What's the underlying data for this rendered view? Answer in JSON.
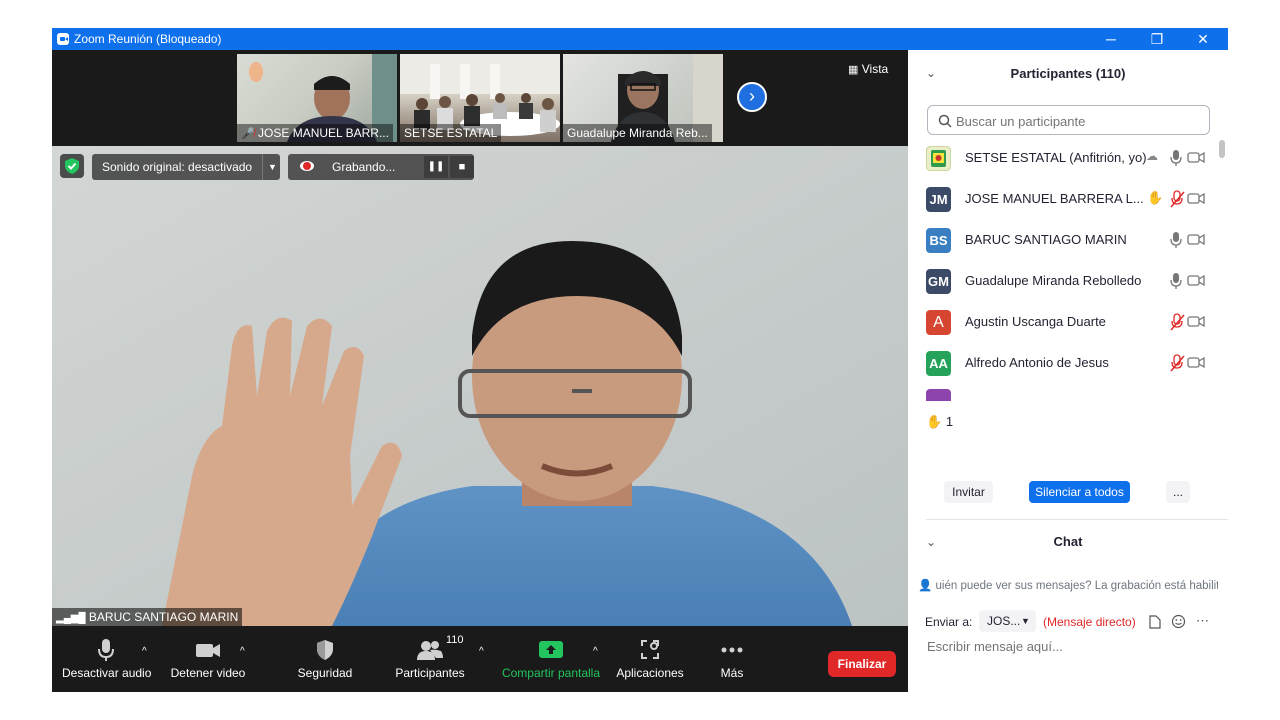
{
  "window": {
    "title": "Zoom Reunión (Bloqueado)"
  },
  "thumbnails": [
    {
      "name": "JOSE MANUEL BARR..."
    },
    {
      "name": "SETSE ESTATAL"
    },
    {
      "name": "Guadalupe Miranda Reb..."
    }
  ],
  "view": {
    "label": "Vista"
  },
  "audio_chip": {
    "label": "Sonido original: desactivado"
  },
  "recording": {
    "label": "Grabando..."
  },
  "speaker": {
    "name": "BARUC SANTIAGO MARIN"
  },
  "toolbar": {
    "audio": "Desactivar audio",
    "video": "Detener video",
    "security": "Seguridad",
    "participants": "Participantes",
    "participants_count": "110",
    "share": "Compartir pantalla",
    "apps": "Aplicaciones",
    "more": "Más",
    "end": "Finalizar"
  },
  "participants_panel": {
    "title": "Participantes (110)",
    "search_placeholder": "Buscar un participante",
    "list": [
      {
        "initials": "",
        "name": "SETSE ESTATAL (Anfitrión, yo)",
        "color": "#e9edc8"
      },
      {
        "initials": "JM",
        "name": "JOSE MANUEL BARRERA L...",
        "color": "#3b4a66"
      },
      {
        "initials": "BS",
        "name": "BARUC SANTIAGO MARIN",
        "color": "#3a7fc1"
      },
      {
        "initials": "GM",
        "name": "Guadalupe Miranda Rebolledo",
        "color": "#3b4a66"
      },
      {
        "initials": "A",
        "name": "Agustin Uscanga Duarte",
        "color": "#d5452f"
      },
      {
        "initials": "AA",
        "name": "Alfredo Antonio de Jesus",
        "color": "#26a35a"
      }
    ],
    "raised_hands": "1",
    "invite": "Invitar",
    "mute_all": "Silenciar a todos",
    "more": "..."
  },
  "chat": {
    "title": "Chat",
    "notice": "uién puede ver sus mensajes? La grabación está habilit",
    "send_to_label": "Enviar a:",
    "recipient": "JOS...",
    "direct": "(Mensaje directo)",
    "input_placeholder": "Escribir mensaje aquí..."
  },
  "colors": {
    "accent": "#0e71eb",
    "end": "#e02828",
    "share": "#22c55e",
    "muted": "#e02828"
  }
}
